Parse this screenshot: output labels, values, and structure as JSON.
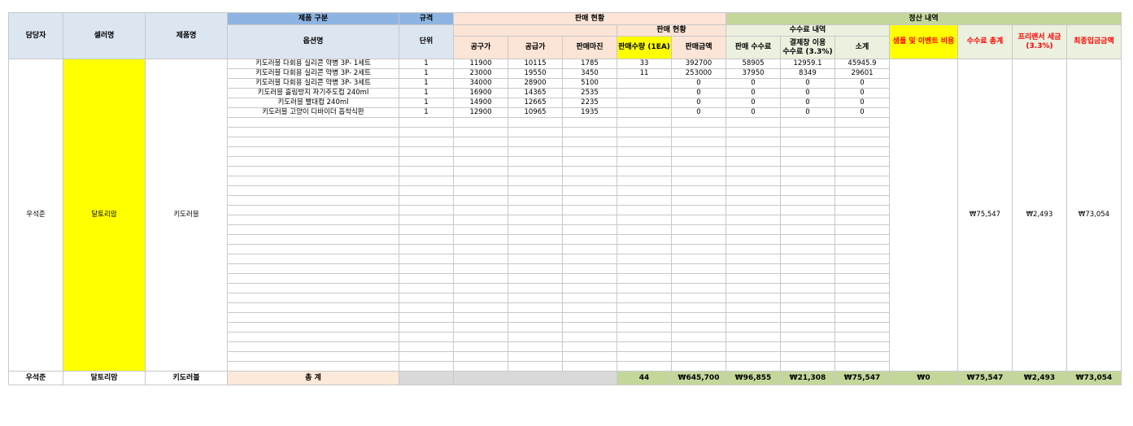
{
  "headers": {
    "manager": "담당자",
    "seller": "셀러명",
    "product": "제품명",
    "product_category": "제품 구분",
    "spec": "규격",
    "sales_status": "판매 현황",
    "settlement": "정산 내역",
    "option_name": "옵션명",
    "unit": "단위",
    "sales_status_sub": "판매 현황",
    "fee_detail": "수수료 내역",
    "sample_event": "샘플 및 이벤트 비용",
    "fee_total": "수수료 총계",
    "freelancer_tax": "프리랜서 세금\n(3.3%)",
    "final_deposit": "최종입금금액",
    "group_price": "공구가",
    "supply_price": "공급가",
    "sales_margin": "판매마진",
    "sales_qty": "판매수량 (1EA)",
    "sales_amount": "판매금액",
    "sales_fee": "판매 수수료",
    "payment_fee": "결제창 이용\n수수료 (3.3%)",
    "subtotal": "소계"
  },
  "rows": [
    {
      "option": "키도러블 다회용 실리콘 약병 3P- 1세트",
      "unit": "1",
      "group_price": "11900",
      "supply_price": "10115",
      "margin": "1785",
      "qty": "33",
      "amount": "392700",
      "sales_fee": "58905",
      "payment_fee": "12959.1",
      "subtotal": "45945.9"
    },
    {
      "option": "키도러블 다회용 실리콘 약병 3P- 2세트",
      "unit": "1",
      "group_price": "23000",
      "supply_price": "19550",
      "margin": "3450",
      "qty": "11",
      "amount": "253000",
      "sales_fee": "37950",
      "payment_fee": "8349",
      "subtotal": "29601"
    },
    {
      "option": "키도러블 다회용 실리콘 약병 3P- 3세트",
      "unit": "1",
      "group_price": "34000",
      "supply_price": "28900",
      "margin": "5100",
      "qty": "",
      "amount": "0",
      "sales_fee": "0",
      "payment_fee": "0",
      "subtotal": "0"
    },
    {
      "option": "키도러블 흘림방지 자기주도컵 240ml",
      "unit": "1",
      "group_price": "16900",
      "supply_price": "14365",
      "margin": "2535",
      "qty": "",
      "amount": "0",
      "sales_fee": "0",
      "payment_fee": "0",
      "subtotal": "0"
    },
    {
      "option": "키도러블 빨대컵 240ml",
      "unit": "1",
      "group_price": "14900",
      "supply_price": "12665",
      "margin": "2235",
      "qty": "",
      "amount": "0",
      "sales_fee": "0",
      "payment_fee": "0",
      "subtotal": "0"
    },
    {
      "option": "키도러블 고양이 디바이더 흡착식판",
      "unit": "1",
      "group_price": "12900",
      "supply_price": "10965",
      "margin": "1935",
      "qty": "",
      "amount": "0",
      "sales_fee": "0",
      "payment_fee": "0",
      "subtotal": "0"
    }
  ],
  "merged": {
    "manager": "우석준",
    "seller": "달토리맘",
    "product": "키도러블",
    "fee_total": "₩75,547",
    "freelancer_tax": "₩2,493",
    "final_deposit": "₩73,054"
  },
  "total_row": {
    "manager": "우석준",
    "seller": "달토리맘",
    "product": "키도러블",
    "label": "총 계",
    "qty": "44",
    "amount": "₩645,700",
    "sales_fee": "₩96,855",
    "payment_fee": "₩21,308",
    "subtotal": "₩75,547",
    "sample_event": "₩0",
    "fee_total": "₩75,547",
    "freelancer_tax": "₩2,493",
    "final_deposit": "₩73,054"
  }
}
